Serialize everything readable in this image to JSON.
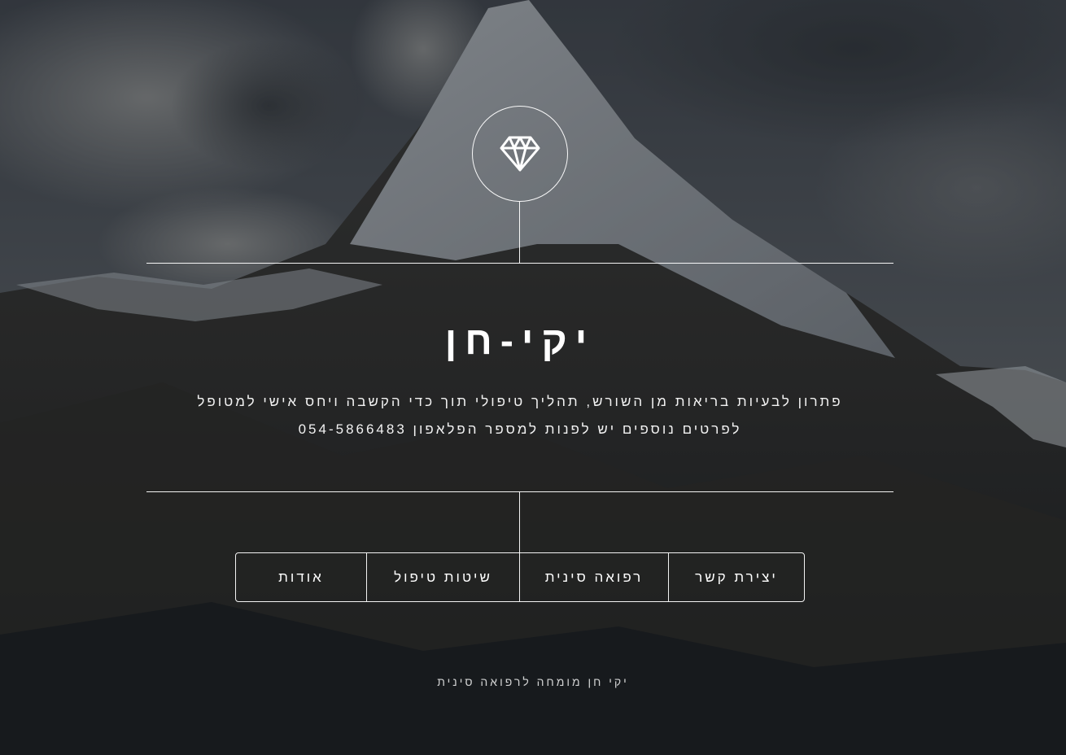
{
  "header": {
    "logo_icon": "diamond-icon",
    "title": "יקי-חן",
    "tagline_lines": [
      "פתרון לבעיות בריאות מן השורש, תהליך טיפולי תוך כדי הקשבה ויחס אישי למטופל",
      "לפרטים נוספים יש לפנות למספר הפלאפון 054-5866483"
    ]
  },
  "nav": {
    "items": [
      {
        "label": "אודות"
      },
      {
        "label": "שיטות טיפול"
      },
      {
        "label": "רפואה סינית"
      },
      {
        "label": "יצירת קשר"
      }
    ]
  },
  "footer": {
    "text": "יקי חן מומחה לרפואה סינית"
  },
  "colors": {
    "text": "#ffffff",
    "overlay": "#1b1f26"
  }
}
